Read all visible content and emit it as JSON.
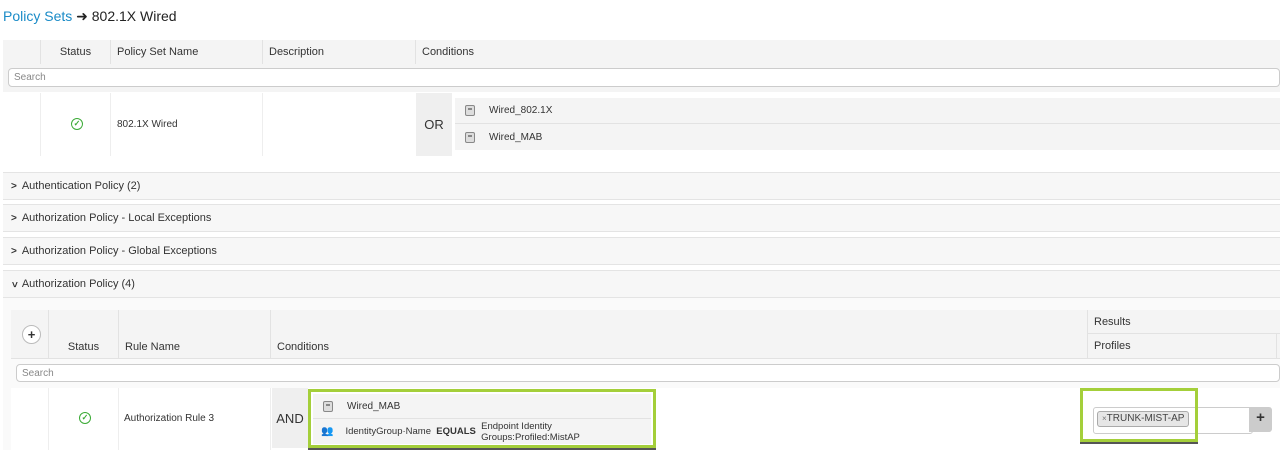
{
  "breadcrumb": {
    "link": "Policy Sets",
    "arrow": "➜",
    "current": "802.1X Wired"
  },
  "policy_table": {
    "headers": [
      "Status",
      "Policy Set Name",
      "Description",
      "Conditions"
    ],
    "search_placeholder": "Search",
    "row": {
      "status": "enabled",
      "name": "802.1X Wired",
      "description": "",
      "operator": "OR",
      "conditions": [
        "Wired_802.1X",
        "Wired_MAB"
      ]
    }
  },
  "sections": [
    {
      "label": "Authentication Policy (2)",
      "expanded": false
    },
    {
      "label": "Authorization Policy - Local Exceptions",
      "expanded": false
    },
    {
      "label": "Authorization Policy - Global Exceptions",
      "expanded": false
    },
    {
      "label": "Authorization Policy (4)",
      "expanded": true
    }
  ],
  "authz_table": {
    "add_label": "+",
    "headers": {
      "status": "Status",
      "rule_name": "Rule Name",
      "conditions": "Conditions",
      "results": "Results",
      "profiles": "Profiles"
    },
    "search_placeholder": "Search",
    "row": {
      "status": "enabled",
      "name": "Authorization Rule 3",
      "operator": "AND",
      "condition1": "Wired_MAB",
      "condition2": {
        "attribute": "IdentityGroup·Name",
        "operator": "EQUALS",
        "value": "Endpoint Identity Groups:Profiled:MistAP"
      },
      "profile": "TRUNK-MIST-AP",
      "profile_remove": "×",
      "add_profile": "+"
    }
  },
  "colors": {
    "accent": "#1a8bc7",
    "highlight": "#a4cf3a",
    "status_ok": "#3aaa35"
  }
}
